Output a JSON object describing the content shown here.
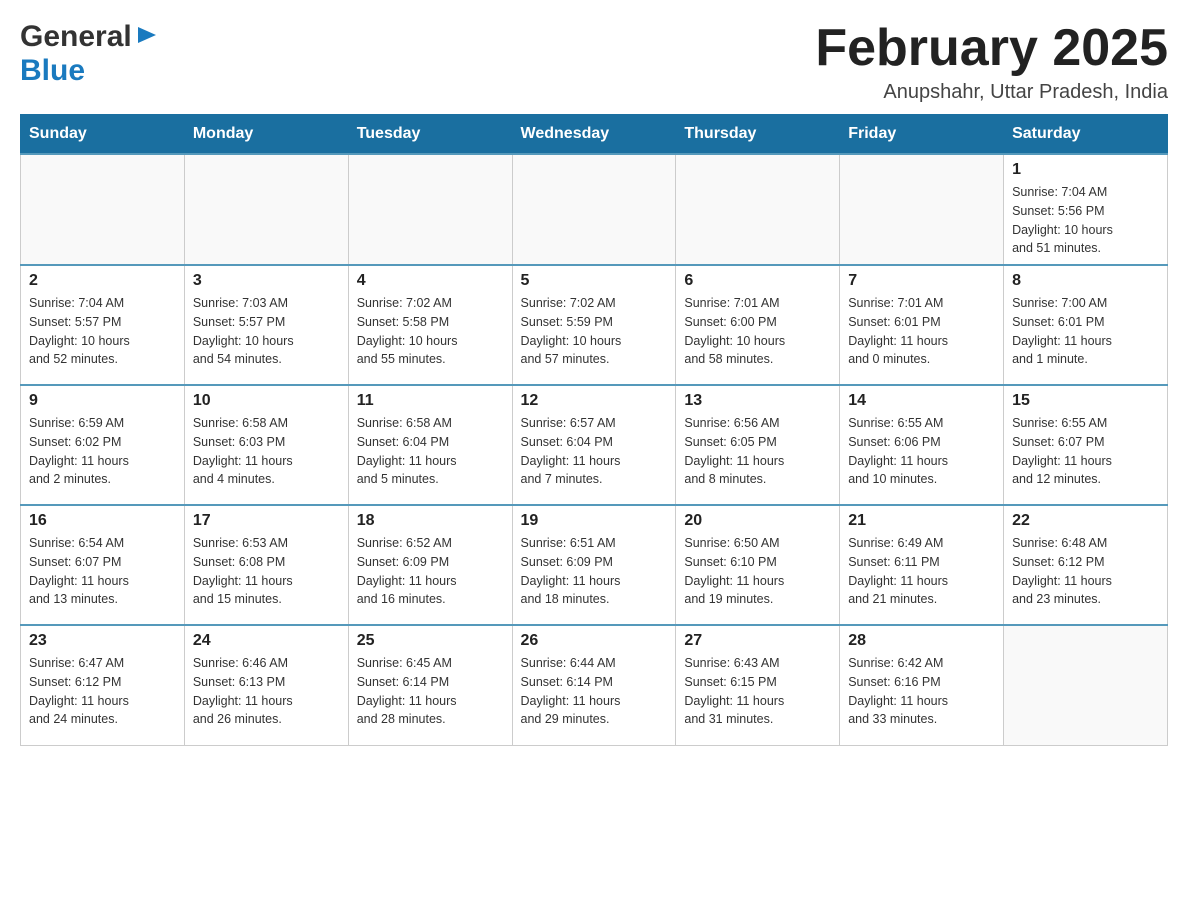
{
  "header": {
    "logo": {
      "general": "General",
      "blue": "Blue"
    },
    "title": "February 2025",
    "location": "Anupshahr, Uttar Pradesh, India"
  },
  "weekdays": [
    "Sunday",
    "Monday",
    "Tuesday",
    "Wednesday",
    "Thursday",
    "Friday",
    "Saturday"
  ],
  "weeks": [
    [
      {
        "day": "",
        "info": ""
      },
      {
        "day": "",
        "info": ""
      },
      {
        "day": "",
        "info": ""
      },
      {
        "day": "",
        "info": ""
      },
      {
        "day": "",
        "info": ""
      },
      {
        "day": "",
        "info": ""
      },
      {
        "day": "1",
        "info": "Sunrise: 7:04 AM\nSunset: 5:56 PM\nDaylight: 10 hours\nand 51 minutes."
      }
    ],
    [
      {
        "day": "2",
        "info": "Sunrise: 7:04 AM\nSunset: 5:57 PM\nDaylight: 10 hours\nand 52 minutes."
      },
      {
        "day": "3",
        "info": "Sunrise: 7:03 AM\nSunset: 5:57 PM\nDaylight: 10 hours\nand 54 minutes."
      },
      {
        "day": "4",
        "info": "Sunrise: 7:02 AM\nSunset: 5:58 PM\nDaylight: 10 hours\nand 55 minutes."
      },
      {
        "day": "5",
        "info": "Sunrise: 7:02 AM\nSunset: 5:59 PM\nDaylight: 10 hours\nand 57 minutes."
      },
      {
        "day": "6",
        "info": "Sunrise: 7:01 AM\nSunset: 6:00 PM\nDaylight: 10 hours\nand 58 minutes."
      },
      {
        "day": "7",
        "info": "Sunrise: 7:01 AM\nSunset: 6:01 PM\nDaylight: 11 hours\nand 0 minutes."
      },
      {
        "day": "8",
        "info": "Sunrise: 7:00 AM\nSunset: 6:01 PM\nDaylight: 11 hours\nand 1 minute."
      }
    ],
    [
      {
        "day": "9",
        "info": "Sunrise: 6:59 AM\nSunset: 6:02 PM\nDaylight: 11 hours\nand 2 minutes."
      },
      {
        "day": "10",
        "info": "Sunrise: 6:58 AM\nSunset: 6:03 PM\nDaylight: 11 hours\nand 4 minutes."
      },
      {
        "day": "11",
        "info": "Sunrise: 6:58 AM\nSunset: 6:04 PM\nDaylight: 11 hours\nand 5 minutes."
      },
      {
        "day": "12",
        "info": "Sunrise: 6:57 AM\nSunset: 6:04 PM\nDaylight: 11 hours\nand 7 minutes."
      },
      {
        "day": "13",
        "info": "Sunrise: 6:56 AM\nSunset: 6:05 PM\nDaylight: 11 hours\nand 8 minutes."
      },
      {
        "day": "14",
        "info": "Sunrise: 6:55 AM\nSunset: 6:06 PM\nDaylight: 11 hours\nand 10 minutes."
      },
      {
        "day": "15",
        "info": "Sunrise: 6:55 AM\nSunset: 6:07 PM\nDaylight: 11 hours\nand 12 minutes."
      }
    ],
    [
      {
        "day": "16",
        "info": "Sunrise: 6:54 AM\nSunset: 6:07 PM\nDaylight: 11 hours\nand 13 minutes."
      },
      {
        "day": "17",
        "info": "Sunrise: 6:53 AM\nSunset: 6:08 PM\nDaylight: 11 hours\nand 15 minutes."
      },
      {
        "day": "18",
        "info": "Sunrise: 6:52 AM\nSunset: 6:09 PM\nDaylight: 11 hours\nand 16 minutes."
      },
      {
        "day": "19",
        "info": "Sunrise: 6:51 AM\nSunset: 6:09 PM\nDaylight: 11 hours\nand 18 minutes."
      },
      {
        "day": "20",
        "info": "Sunrise: 6:50 AM\nSunset: 6:10 PM\nDaylight: 11 hours\nand 19 minutes."
      },
      {
        "day": "21",
        "info": "Sunrise: 6:49 AM\nSunset: 6:11 PM\nDaylight: 11 hours\nand 21 minutes."
      },
      {
        "day": "22",
        "info": "Sunrise: 6:48 AM\nSunset: 6:12 PM\nDaylight: 11 hours\nand 23 minutes."
      }
    ],
    [
      {
        "day": "23",
        "info": "Sunrise: 6:47 AM\nSunset: 6:12 PM\nDaylight: 11 hours\nand 24 minutes."
      },
      {
        "day": "24",
        "info": "Sunrise: 6:46 AM\nSunset: 6:13 PM\nDaylight: 11 hours\nand 26 minutes."
      },
      {
        "day": "25",
        "info": "Sunrise: 6:45 AM\nSunset: 6:14 PM\nDaylight: 11 hours\nand 28 minutes."
      },
      {
        "day": "26",
        "info": "Sunrise: 6:44 AM\nSunset: 6:14 PM\nDaylight: 11 hours\nand 29 minutes."
      },
      {
        "day": "27",
        "info": "Sunrise: 6:43 AM\nSunset: 6:15 PM\nDaylight: 11 hours\nand 31 minutes."
      },
      {
        "day": "28",
        "info": "Sunrise: 6:42 AM\nSunset: 6:16 PM\nDaylight: 11 hours\nand 33 minutes."
      },
      {
        "day": "",
        "info": ""
      }
    ]
  ]
}
